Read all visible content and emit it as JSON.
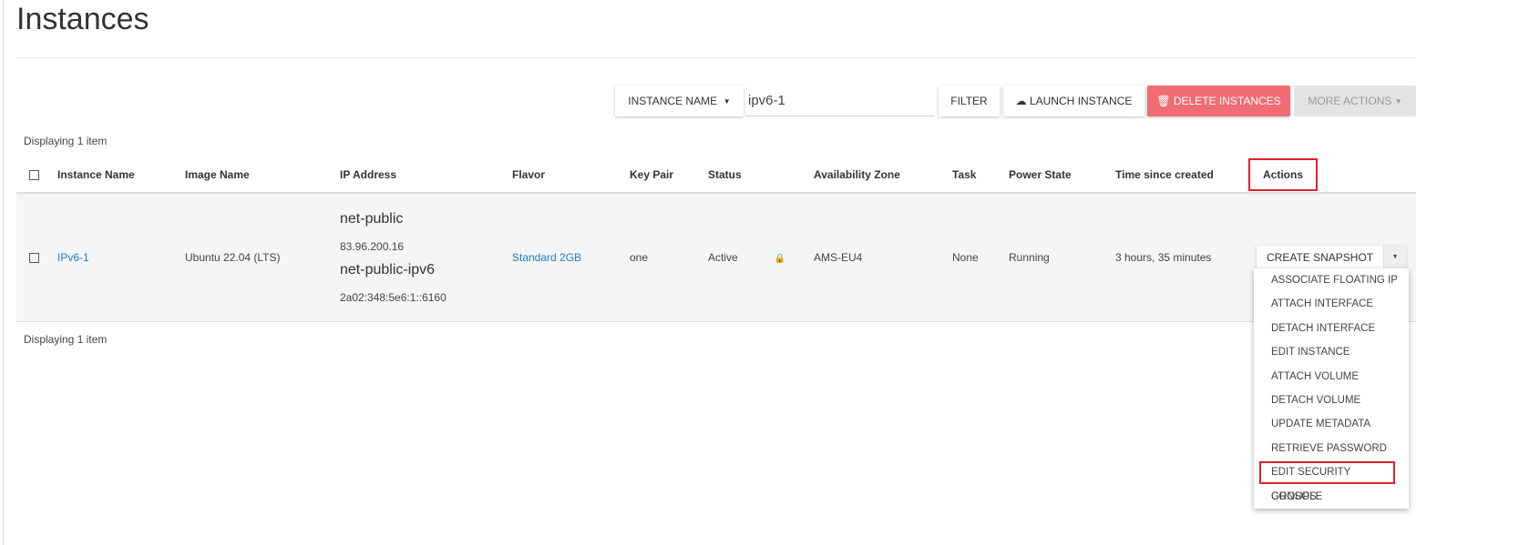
{
  "page": {
    "title": "Instances"
  },
  "toolbar": {
    "filter_field": "INSTANCE NAME",
    "filter_value": "ipv6-1",
    "filter": "FILTER",
    "launch": "LAUNCH INSTANCE",
    "delete": "DELETE INSTANCES",
    "more": "MORE ACTIONS",
    "delete_color": "#ef6c74"
  },
  "summary": "Displaying 1 item",
  "table": {
    "headers": [
      "Instance Name",
      "Image Name",
      "IP Address",
      "Flavor",
      "Key Pair",
      "Status",
      "Availability Zone",
      "Task",
      "Power State",
      "Time since created",
      "Actions"
    ],
    "rows": [
      {
        "name": "IPv6-1",
        "image": "Ubuntu 22.04 (LTS)",
        "net1": "net-public",
        "ip1": "83.96.200.16",
        "net2": "net-public-ipv6",
        "ip2": "2a02:348:5e6:1::6160",
        "flavor": "Standard 2GB",
        "keypair": "one",
        "status": "Active",
        "zone": "AMS-EU4",
        "task": "None",
        "power": "Running",
        "age": "3 hours, 35 minutes",
        "action": "CREATE SNAPSHOT"
      }
    ]
  },
  "menu": [
    "ASSOCIATE FLOATING IP",
    "ATTACH INTERFACE",
    "DETACH INTERFACE",
    "EDIT INSTANCE",
    "ATTACH VOLUME",
    "DETACH VOLUME",
    "UPDATE METADATA",
    "RETRIEVE PASSWORD",
    "EDIT SECURITY GROUPS",
    "CONSOLE"
  ]
}
